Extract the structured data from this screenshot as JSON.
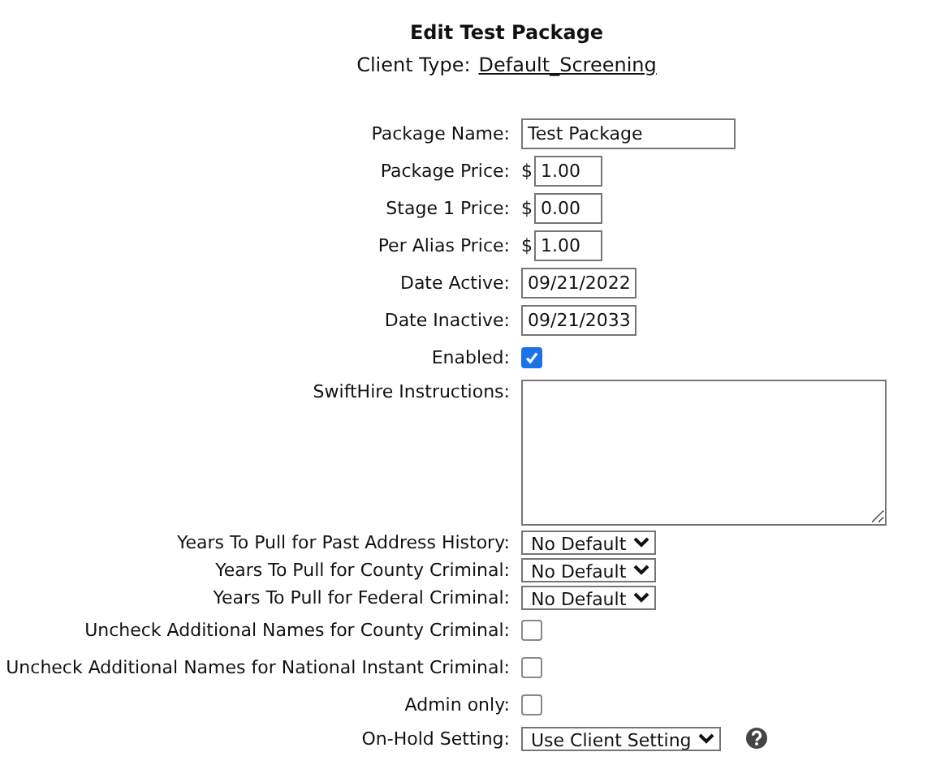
{
  "title": "Edit Test Package",
  "client_type": {
    "label": "Client Type:",
    "link": "Default_Screening"
  },
  "fields": [
    {
      "kind": "text",
      "label": "Package Name:",
      "value": "Test Package"
    },
    {
      "kind": "price",
      "label": "Package Price:",
      "prefix": "$",
      "value": "1.00"
    },
    {
      "kind": "price",
      "label": "Stage 1 Price:",
      "prefix": "$",
      "value": "0.00"
    },
    {
      "kind": "price",
      "label": "Per Alias Price:",
      "prefix": "$",
      "value": "1.00"
    },
    {
      "kind": "date",
      "label": "Date Active:",
      "value": "09/21/2022"
    },
    {
      "kind": "date",
      "label": "Date Inactive:",
      "value": "09/21/2033"
    },
    {
      "kind": "checkbox",
      "label": "Enabled:",
      "checked": true
    },
    {
      "kind": "textarea",
      "label": "SwiftHire Instructions:"
    },
    {
      "kind": "select",
      "label": "Years To Pull for Past Address History:",
      "value": "No Default"
    },
    {
      "kind": "select",
      "label": "Years To Pull for County Criminal:",
      "value": "No Default"
    },
    {
      "kind": "select",
      "label": "Years To Pull for Federal Criminal:",
      "value": "No Default"
    },
    {
      "kind": "checkbox",
      "label": "Uncheck Additional Names for County Criminal:",
      "checked": false
    },
    {
      "kind": "checkbox",
      "label": "Uncheck Additional Names for National Instant Criminal:",
      "checked": false
    },
    {
      "kind": "checkbox",
      "label": "Admin only:",
      "checked": false
    },
    {
      "kind": "select",
      "label": "On-Hold Setting:",
      "value": "Use Client Setting",
      "help": true
    }
  ]
}
